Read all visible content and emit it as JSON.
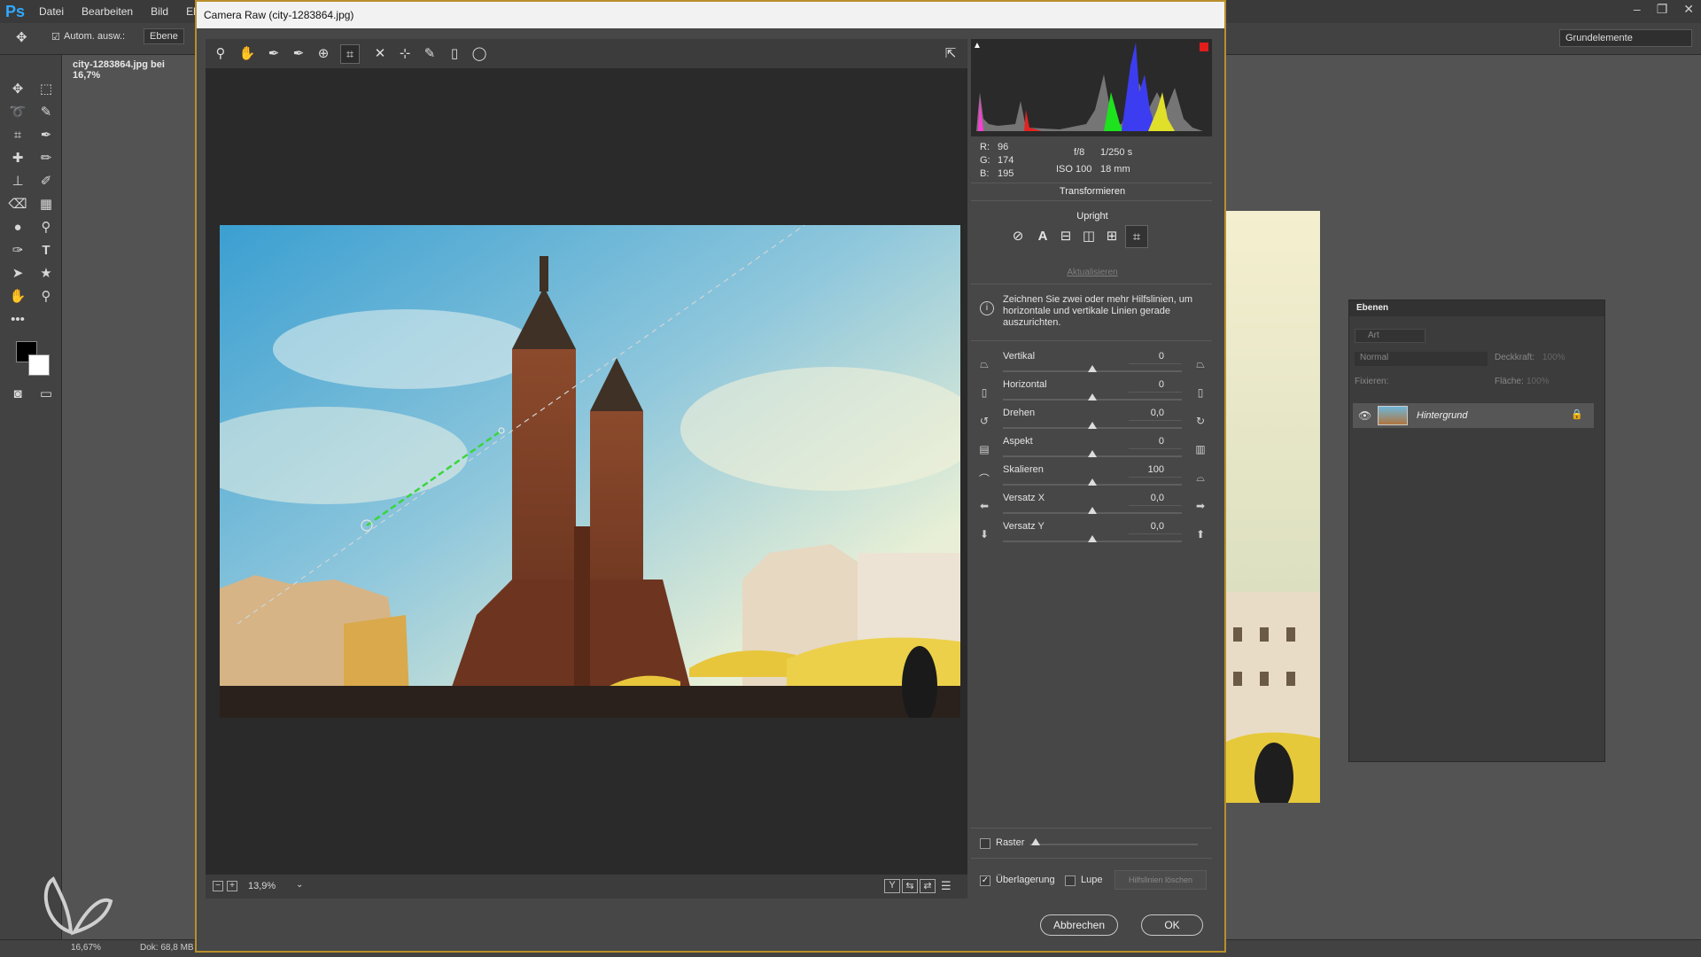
{
  "ps": {
    "logo": "Ps",
    "menu": [
      "Datei",
      "Bearbeiten",
      "Bild",
      "Eb"
    ],
    "options": {
      "auto_select": "Autom. ausw.:",
      "auto_select_target": "Ebene"
    },
    "workspace": "Grundelemente",
    "doc_tab": "city-1283864.jpg bei 16,7%",
    "status_zoom": "16,67%",
    "status_doc": "Dok: 68,8 MB"
  },
  "dialog": {
    "title": "Camera Raw (city-1283864.jpg)",
    "zoom": "13,9%",
    "cancel_label": "Abbrechen",
    "ok_label": "OK"
  },
  "info": {
    "r_label": "R:",
    "r": "96",
    "g_label": "G:",
    "g": "174",
    "b_label": "B:",
    "b": "195",
    "aperture": "f/8",
    "shutter": "1/250 s",
    "iso": "ISO 100",
    "focal": "18 mm"
  },
  "transform": {
    "panel_title": "Transformieren",
    "upright_label": "Upright",
    "update_link": "Aktualisieren",
    "hint": "Zeichnen Sie zwei oder mehr Hilfslinien, um horizontale und vertikale Linien gerade auszurichten.",
    "sliders": [
      {
        "label": "Vertikal",
        "value": "0",
        "position": 0.5
      },
      {
        "label": "Horizontal",
        "value": "0",
        "position": 0.5
      },
      {
        "label": "Drehen",
        "value": "0,0",
        "position": 0.5
      },
      {
        "label": "Aspekt",
        "value": "0",
        "position": 0.5
      },
      {
        "label": "Skalieren",
        "value": "100",
        "position": 0.5
      },
      {
        "label": "Versatz X",
        "value": "0,0",
        "position": 0.5
      },
      {
        "label": "Versatz Y",
        "value": "0,0",
        "position": 0.5
      }
    ],
    "grid_label": "Raster",
    "overlay_label": "Überlagerung",
    "loupe_label": "Lupe",
    "clear_guides_label": "Hilfslinien löschen"
  },
  "layers": {
    "panel_title": "Ebenen",
    "search_placeholder": "Art",
    "blend_mode": "Normal",
    "opacity_label": "Deckkraft:",
    "opacity_value": "100%",
    "lock_label": "Fixieren:",
    "fill_label": "Fläche:",
    "fill_value": "100%",
    "layer_name": "Hintergrund"
  },
  "colors": {
    "ps_blue": "#31a8ff",
    "dialog_border": "#b98f2b",
    "guide_green": "#3ad63a"
  }
}
